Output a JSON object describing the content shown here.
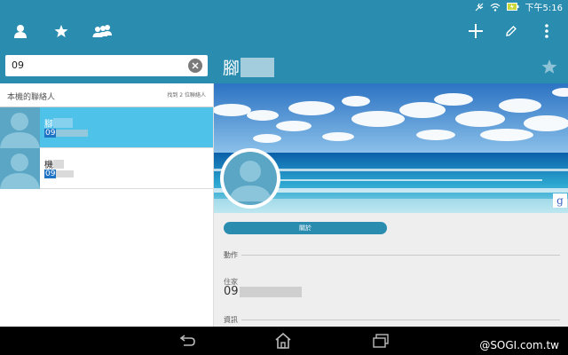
{
  "status_bar": {
    "time": "下午5:16"
  },
  "action_bar": {
    "tabs": [
      {
        "name": "contacts",
        "icon": "person-icon"
      },
      {
        "name": "favorites",
        "icon": "star-icon"
      },
      {
        "name": "groups",
        "icon": "group-icon"
      }
    ],
    "actions": [
      "add-icon",
      "edit-icon",
      "overflow-icon"
    ]
  },
  "search": {
    "value": "09"
  },
  "list": {
    "section_title": "本機的聯絡人",
    "count_text": "找到 2 位聯絡人",
    "items": [
      {
        "name": "腳",
        "number": "09",
        "selected": true
      },
      {
        "name": "機",
        "number": "09",
        "selected": false
      }
    ]
  },
  "detail": {
    "name": "腳",
    "about_label": "關於",
    "actions_section": "動作",
    "phone_label": "住家",
    "phone_value": "09",
    "info_section": "資訊"
  },
  "watermark": "@SOGI.com.tw",
  "colors": {
    "accent": "#2a8db0",
    "selected_row": "#4fc2ea",
    "highlight": "#1f73c4"
  }
}
